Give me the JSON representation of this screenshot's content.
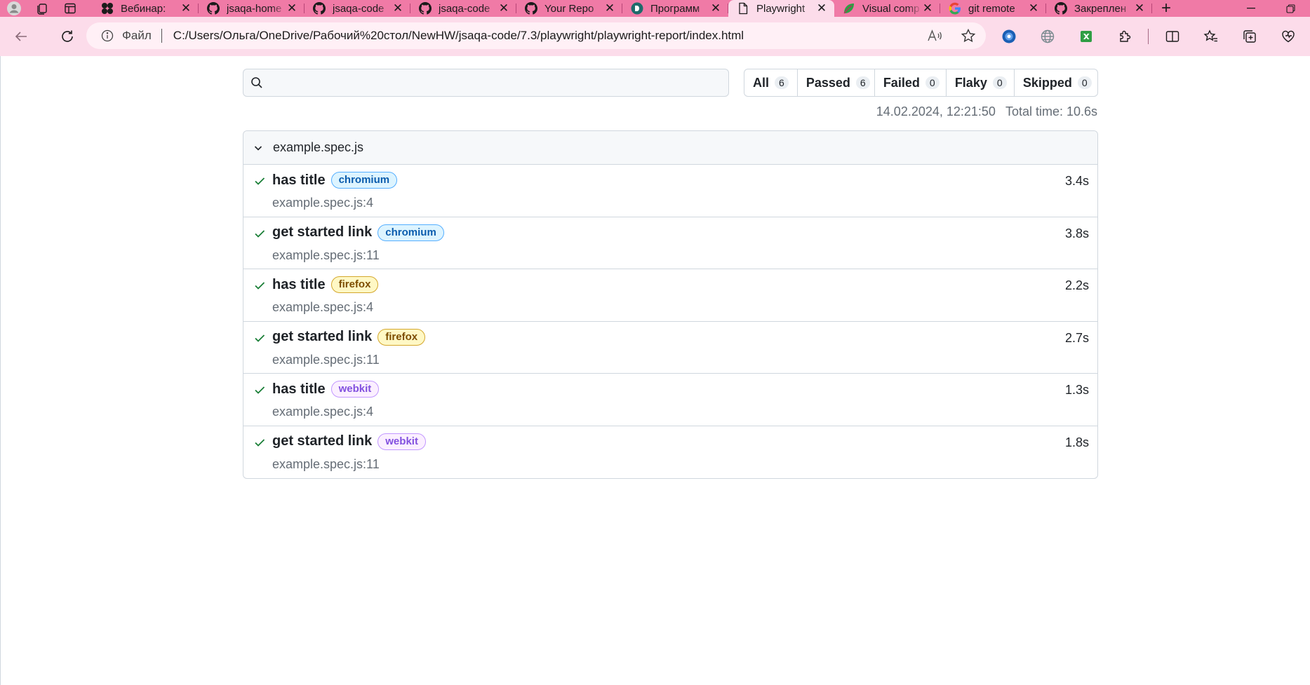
{
  "browser": {
    "tabs": [
      {
        "title": "Вебинар:",
        "icon": "dots-logo-icon",
        "active": false
      },
      {
        "title": "jsaqa-home",
        "icon": "github-icon",
        "active": false
      },
      {
        "title": "jsaqa-code",
        "icon": "github-icon",
        "active": false
      },
      {
        "title": "jsaqa-code",
        "icon": "github-icon",
        "active": false
      },
      {
        "title": "Your Repo",
        "icon": "github-icon",
        "active": false
      },
      {
        "title": "Программ",
        "icon": "course-logo-icon",
        "active": false
      },
      {
        "title": "Playwright",
        "icon": "page-icon",
        "active": true
      },
      {
        "title": "Visual comp",
        "icon": "leaf-icon",
        "active": false
      },
      {
        "title": "git remote",
        "icon": "google-icon",
        "active": false
      },
      {
        "title": "Закреплен",
        "icon": "github-icon",
        "active": false
      }
    ],
    "address": {
      "scheme_label": "Файл",
      "url": "C:/Users/Ольга/OneDrive/Рабочий%20стол/NewHW/jsaqa-code/7.3/playwright/playwright-report/index.html"
    }
  },
  "report": {
    "search": {
      "placeholder": "",
      "value": ""
    },
    "filters": [
      {
        "label": "All",
        "count": "6"
      },
      {
        "label": "Passed",
        "count": "6"
      },
      {
        "label": "Failed",
        "count": "0"
      },
      {
        "label": "Flaky",
        "count": "0"
      },
      {
        "label": "Skipped",
        "count": "0"
      }
    ],
    "timestamp": "14.02.2024, 12:21:50",
    "total_time": "Total time: 10.6s",
    "file": {
      "name": "example.spec.js",
      "tests": [
        {
          "title": "has title",
          "project": "chromium",
          "location": "example.spec.js:4",
          "duration": "3.4s",
          "status": "passed"
        },
        {
          "title": "get started link",
          "project": "chromium",
          "location": "example.spec.js:11",
          "duration": "3.8s",
          "status": "passed"
        },
        {
          "title": "has title",
          "project": "firefox",
          "location": "example.spec.js:4",
          "duration": "2.2s",
          "status": "passed"
        },
        {
          "title": "get started link",
          "project": "firefox",
          "location": "example.spec.js:11",
          "duration": "2.7s",
          "status": "passed"
        },
        {
          "title": "has title",
          "project": "webkit",
          "location": "example.spec.js:4",
          "duration": "1.3s",
          "status": "passed"
        },
        {
          "title": "get started link",
          "project": "webkit",
          "location": "example.spec.js:11",
          "duration": "1.8s",
          "status": "passed"
        }
      ]
    }
  },
  "colors": {
    "tabstrip": "#f07aa6",
    "toolbar": "#fcdcea",
    "passed_check": "#1a7f37",
    "chromium_badge": "#0b5cad",
    "firefox_badge": "#7d4e00",
    "webkit_badge": "#8250df"
  }
}
